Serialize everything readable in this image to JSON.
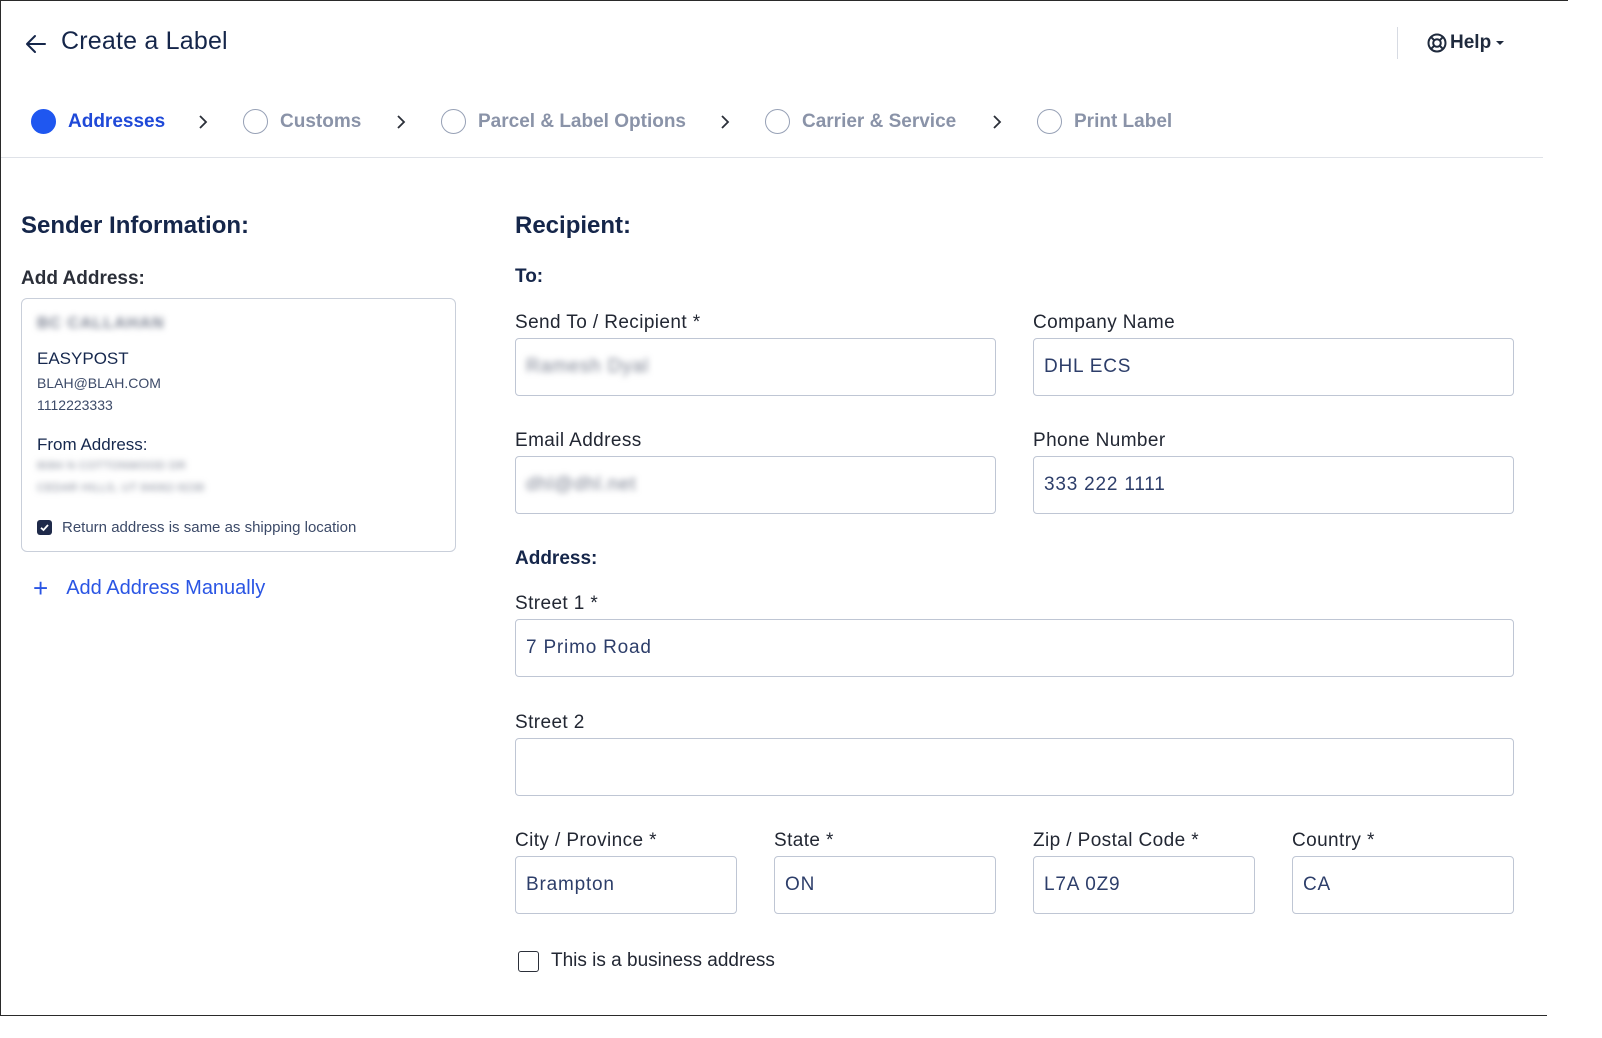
{
  "header": {
    "title": "Create a Label",
    "help_label": "Help"
  },
  "stepper": {
    "steps": [
      {
        "label": "Addresses",
        "active": true
      },
      {
        "label": "Customs",
        "active": false
      },
      {
        "label": "Parcel & Label Options",
        "active": false
      },
      {
        "label": "Carrier & Service",
        "active": false
      },
      {
        "label": "Print Label",
        "active": false
      }
    ]
  },
  "sender": {
    "title": "Sender Information:",
    "add_address_label": "Add Address:",
    "card": {
      "name": "BC CALLAHAN",
      "company": "EASYPOST",
      "email": "BLAH@BLAH.COM",
      "phone": "1112223333",
      "from_label": "From Address:",
      "from_line1": "8084 N COTTONWOOD DR",
      "from_line2": "CEDAR HILLS, UT 84062-9238",
      "return_same_label": "Return address is same as shipping location",
      "return_same_checked": true
    },
    "add_manually_label": "Add Address Manually"
  },
  "recipient": {
    "title": "Recipient:",
    "to_label": "To:",
    "send_to": {
      "label": "Send To / Recipient *",
      "value": "Ramesh Dyal"
    },
    "company": {
      "label": "Company Name",
      "value": "DHL ECS"
    },
    "email": {
      "label": "Email Address",
      "value": "dhl@dhl.net"
    },
    "phone": {
      "label": "Phone Number",
      "value": "333 222 1111"
    },
    "address_label": "Address:",
    "street1": {
      "label": "Street 1 *",
      "value": "7 Primo Road"
    },
    "street2": {
      "label": "Street 2",
      "value": ""
    },
    "city": {
      "label": "City / Province *",
      "value": "Brampton"
    },
    "state": {
      "label": "State *",
      "value": "ON"
    },
    "zip": {
      "label": "Zip / Postal Code *",
      "value": "L7A 0Z9"
    },
    "country": {
      "label": "Country *",
      "value": "CA"
    },
    "business_label": "This is a business address",
    "business_checked": false
  },
  "colors": {
    "accent": "#1f57f0",
    "title_navy": "#15264a",
    "border": "#bfc6d4"
  }
}
